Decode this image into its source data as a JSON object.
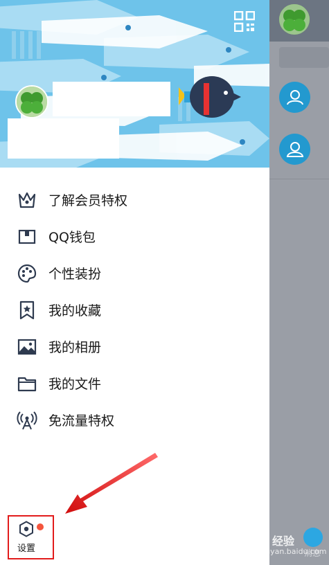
{
  "menu": {
    "items": [
      {
        "label": "了解会员特权",
        "icon": "crown-icon"
      },
      {
        "label": "QQ钱包",
        "icon": "wallet-icon"
      },
      {
        "label": "个性装扮",
        "icon": "palette-icon"
      },
      {
        "label": "我的收藏",
        "icon": "bookmark-star-icon"
      },
      {
        "label": "我的相册",
        "icon": "image-icon"
      },
      {
        "label": "我的文件",
        "icon": "folder-icon"
      },
      {
        "label": "免流量特权",
        "icon": "antenna-icon"
      }
    ]
  },
  "settings": {
    "label": "设置",
    "icon": "settings-hexagon-icon",
    "badge_color": "#f4553d"
  },
  "right_panel": {
    "tab_label": "消息"
  },
  "watermark": {
    "text": "Bai 经验",
    "url": "jingyan.baidu.com"
  },
  "colors": {
    "header_bg": "#6ec3ea",
    "accent": "#2399cf",
    "highlight_box": "#e21b1b"
  }
}
